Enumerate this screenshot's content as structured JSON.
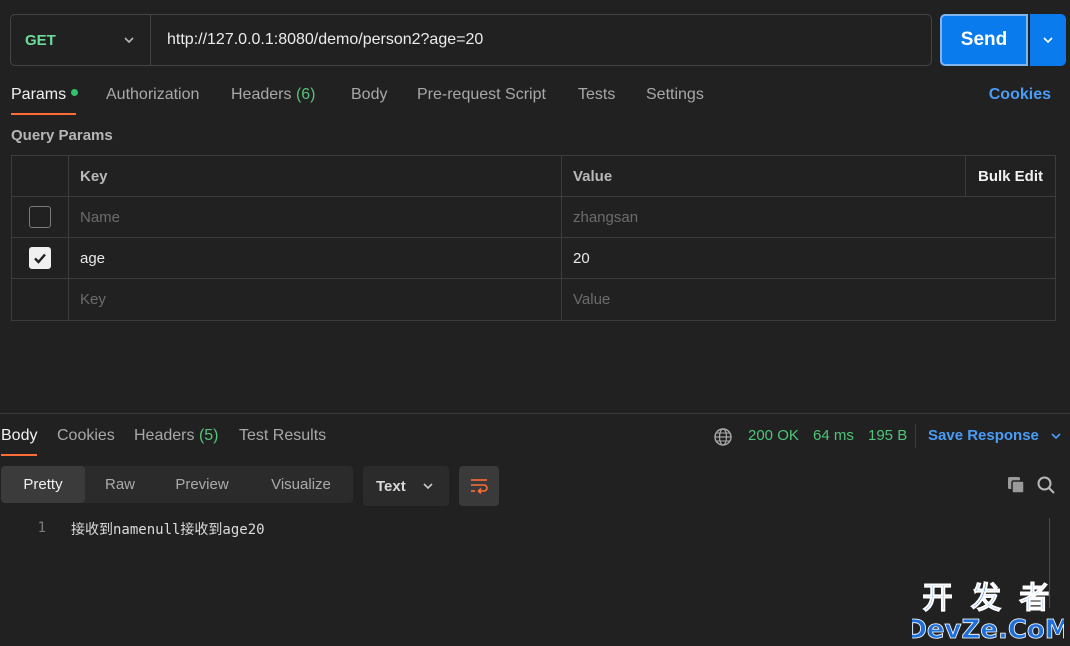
{
  "request": {
    "method": "GET",
    "url": "http://127.0.0.1:8080/demo/person2?age=20",
    "send_label": "Send"
  },
  "request_tabs": [
    {
      "label": "Params",
      "count": "",
      "active": true,
      "dot": true
    },
    {
      "label": "Authorization",
      "count": ""
    },
    {
      "label": "Headers",
      "count": "(6)"
    },
    {
      "label": "Body",
      "count": ""
    },
    {
      "label": "Pre-request Script",
      "count": ""
    },
    {
      "label": "Tests",
      "count": ""
    },
    {
      "label": "Settings",
      "count": ""
    }
  ],
  "cookies_label": "Cookies",
  "query_params": {
    "title": "Query Params",
    "headers": {
      "key": "Key",
      "value": "Value",
      "bulk_edit": "Bulk Edit"
    },
    "rows": [
      {
        "checked": false,
        "key": "",
        "key_placeholder": "Name",
        "value": "",
        "value_placeholder": "zhangsan"
      },
      {
        "checked": true,
        "key": "age",
        "key_placeholder": "",
        "value": "20",
        "value_placeholder": ""
      },
      {
        "checked": null,
        "key": "",
        "key_placeholder": "Key",
        "value": "",
        "value_placeholder": "Value"
      }
    ]
  },
  "response_tabs": [
    {
      "label": "Body",
      "count": "",
      "active": true
    },
    {
      "label": "Cookies",
      "count": ""
    },
    {
      "label": "Headers",
      "count": "(5)"
    },
    {
      "label": "Test Results",
      "count": ""
    }
  ],
  "response_status": {
    "code": "200 OK",
    "time": "64 ms",
    "size": "195 B"
  },
  "save_response_label": "Save Response",
  "format_tabs": [
    "Pretty",
    "Raw",
    "Preview",
    "Visualize"
  ],
  "format_active": "Pretty",
  "language": "Text",
  "body_lines": [
    {
      "no": "1",
      "text": "接收到namenull接收到age20"
    }
  ],
  "watermark": {
    "line1": "开 发 者",
    "line2": "DevZe.CoM"
  },
  "colors": {
    "accent": "#ff6c37",
    "send": "#097bed",
    "link": "#4a9cf7",
    "status": "#4fc47a",
    "method": "#6bdd9a"
  }
}
